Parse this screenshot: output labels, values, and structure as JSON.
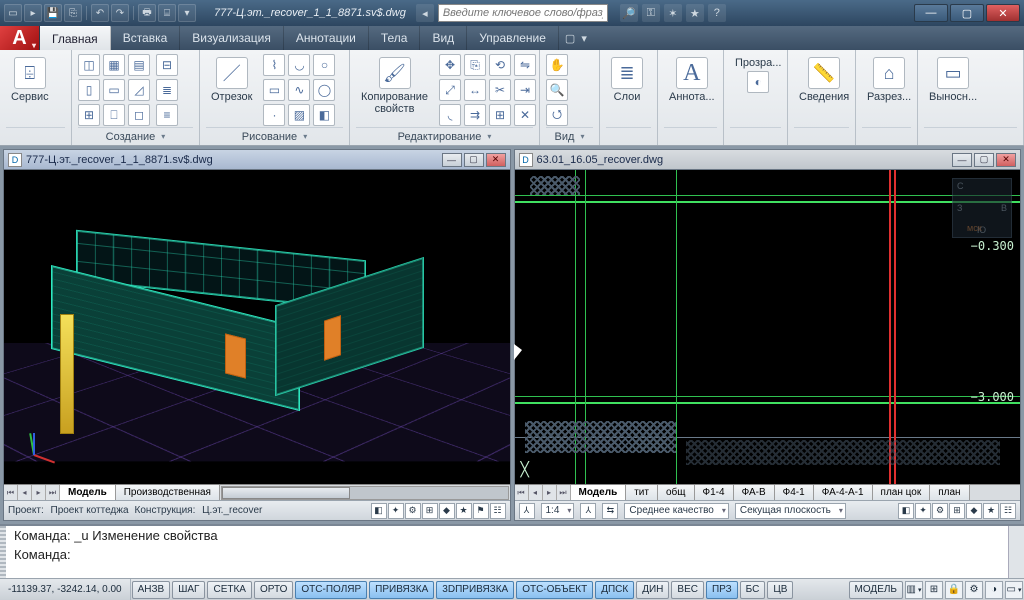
{
  "title_doc": "777-Ц.эт._recover_1_1_8871.sv$.dwg",
  "search_placeholder": "Введите ключевое слово/фразу",
  "menu": {
    "items": [
      "Главная",
      "Вставка",
      "Визуализация",
      "Аннотации",
      "Тела",
      "Вид",
      "Управление"
    ],
    "active": 0
  },
  "ribbon": {
    "service": "Сервис",
    "create_label": "Создание",
    "line_btn": "Отрезок",
    "draw_label": "Рисование",
    "copyprops": "Копирование свойств",
    "edit_label": "Редактирование",
    "view_label": "Вид",
    "layers": "Слои",
    "annot": "Аннота...",
    "transparent": "Прозра...",
    "sved": "Сведения",
    "razrez": "Разрез...",
    "vynos": "Выносн...",
    "A": "А"
  },
  "docs": {
    "left": {
      "title": "777-Ц.эт._recover_1_1_8871.sv$.dwg",
      "tabs": [
        "Модель",
        "Производственная"
      ],
      "active_tab": 0,
      "status_project_lbl": "Проект:",
      "status_project_val": "Проект коттеджа",
      "status_constr_lbl": "Конструкция:",
      "status_constr_val": "Ц.эт._recover"
    },
    "right": {
      "title": "63.01_16.05_recover.dwg",
      "tabs": [
        "Модель",
        "тит",
        "общ",
        "Ф1-4",
        "ФА-В",
        "Ф4-1",
        "ФА-4-А-1",
        "план цок",
        "план"
      ],
      "active_tab": 0,
      "scale": "1:4",
      "quality": "Среднее качество",
      "section": "Секущая плоскость",
      "dim1": "−0.300",
      "dim2": "−3.000"
    }
  },
  "cmd": {
    "line1": "Команда: _u Изменение свойства",
    "line2": "Команда:"
  },
  "status": {
    "coords": "-11139.37, -3242.14, 0.00",
    "toggles": [
      {
        "t": "АНЗВ",
        "on": false
      },
      {
        "t": "ШАГ",
        "on": false
      },
      {
        "t": "СЕТКА",
        "on": false
      },
      {
        "t": "ОРТО",
        "on": false
      },
      {
        "t": "ОТС-ПОЛЯР",
        "on": true
      },
      {
        "t": "ПРИВЯЗКА",
        "on": true
      },
      {
        "t": "3DПРИВЯЗКА",
        "on": true
      },
      {
        "t": "ОТС-ОБЪЕКТ",
        "on": true
      },
      {
        "t": "ДПСК",
        "on": true
      },
      {
        "t": "ДИН",
        "on": false
      },
      {
        "t": "ВЕС",
        "on": false
      },
      {
        "t": "ПРЗ",
        "on": true
      },
      {
        "t": "БС",
        "on": false
      },
      {
        "t": "ЦВ",
        "on": false
      }
    ],
    "model_btn": "МОДЕЛЬ"
  }
}
